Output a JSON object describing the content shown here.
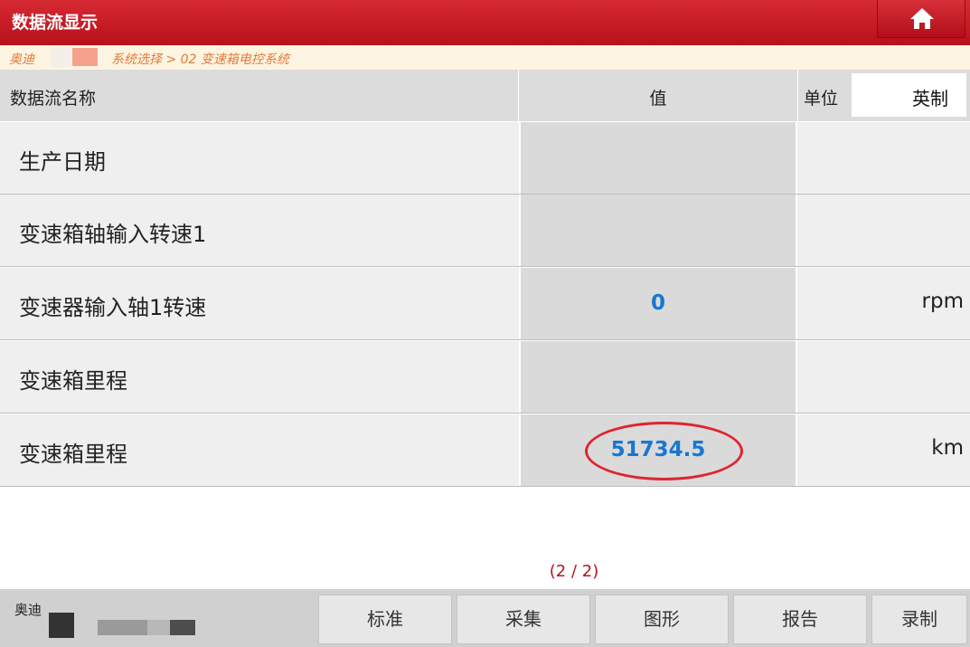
{
  "header": {
    "title": "数据流显示",
    "home_icon": "home-icon"
  },
  "breadcrumb": {
    "make": "奥迪",
    "path": "系统选择 > 02 变速箱电控系统"
  },
  "table": {
    "columns": {
      "name": "数据流名称",
      "value": "值",
      "unit": "单位"
    },
    "unit_system": "英制",
    "rows": [
      {
        "name": "生产日期",
        "value": "",
        "unit": ""
      },
      {
        "name": "变速箱轴输入转速1",
        "value": "",
        "unit": ""
      },
      {
        "name": "变速器输入轴1转速",
        "value": "0",
        "unit": "rpm"
      },
      {
        "name": "变速箱里程",
        "value": "",
        "unit": ""
      },
      {
        "name": "变速箱里程",
        "value": "51734.5",
        "unit": "km"
      }
    ]
  },
  "pager": {
    "text": "(2 / 2)"
  },
  "footer": {
    "make": "奥迪",
    "buttons": [
      "标准",
      "采集",
      "图形",
      "报告",
      "录制"
    ]
  },
  "colors": {
    "brand_red": "#c0141f",
    "value_blue": "#1976d2",
    "highlight": "#e0242f"
  }
}
